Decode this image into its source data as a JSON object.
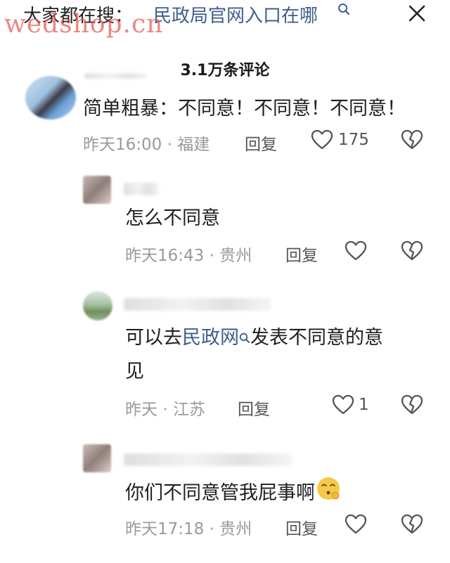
{
  "search": {
    "prefix": "大家都在搜：",
    "query": "民政局官网入口在哪",
    "search_icon": "search-icon",
    "close_icon": "close-icon"
  },
  "watermark": "wedshop.cn",
  "comments_count": "3.1万条评论",
  "comments": [
    {
      "text": "简单粗暴：不同意！不同意！不同意！",
      "time": "昨天16:00",
      "location": "福建",
      "reply_label": "回复",
      "likes": "175"
    },
    {
      "text": "怎么不同意",
      "time": "昨天16:43",
      "location": "贵州",
      "reply_label": "回复",
      "likes": ""
    },
    {
      "text_before": "可以去",
      "link": "民政网",
      "text_after": "发表不同意的意",
      "text_line2": "见",
      "time": "昨天",
      "location": "江苏",
      "reply_label": "回复",
      "likes": "1"
    },
    {
      "text": "你们不同意管我屁事啊",
      "time": "昨天17:18",
      "location": "贵州",
      "reply_label": "回复",
      "likes": ""
    }
  ],
  "colors": {
    "link": "#3f5e8c",
    "meta": "#9a9a9a",
    "watermark": "#e45a4f"
  }
}
